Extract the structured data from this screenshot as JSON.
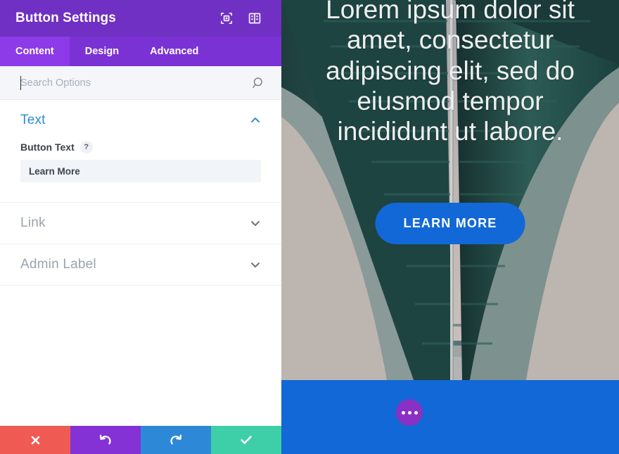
{
  "panel": {
    "title": "Button Settings",
    "header_icons": [
      {
        "name": "focus-target-icon",
        "label": "Focus"
      },
      {
        "name": "panel-layout-icon",
        "label": "Layout"
      }
    ],
    "tabs": [
      {
        "label": "Content",
        "active": true
      },
      {
        "label": "Design",
        "active": false
      },
      {
        "label": "Advanced",
        "active": false
      }
    ],
    "search": {
      "placeholder": "Search Options",
      "value": "",
      "icon": "search-icon"
    },
    "sections": [
      {
        "title": "Text",
        "state": "open",
        "chevron": "chevron-up-icon",
        "field": {
          "label": "Button Text",
          "help": "?",
          "value": "Learn More",
          "placeholder": "Learn More"
        }
      },
      {
        "title": "Link",
        "state": "closed",
        "chevron": "chevron-down-icon"
      },
      {
        "title": "Admin Label",
        "state": "closed",
        "chevron": "chevron-down-icon"
      }
    ],
    "actions": [
      {
        "name": "cancel-button",
        "icon": "close-x-icon",
        "color": "#ef5a52"
      },
      {
        "name": "undo-button",
        "icon": "undo-arrow-icon",
        "color": "#8431d6"
      },
      {
        "name": "redo-button",
        "icon": "redo-arrow-icon",
        "color": "#2e88d8"
      },
      {
        "name": "save-button",
        "icon": "checkmark-icon",
        "color": "#3ecfa8"
      }
    ]
  },
  "preview": {
    "hero_text": "Lorem ipsum dolor sit amet, consectetur adipiscing elit, sed do eiusmod tempor incididunt ut labore.",
    "button_label": "LEARN MORE",
    "button_color": "#1268d6",
    "strip_color": "#1268d6",
    "more_button": {
      "name": "more-options-button",
      "color": "#8b30c4",
      "icon": "ellipsis-icon"
    }
  },
  "colors": {
    "header_purple": "#7030c4",
    "tab_purple": "#7b32d4",
    "tab_active_purple": "#8d3ae8",
    "section_open_blue": "#2e8ece",
    "accent_blue": "#1268d6"
  }
}
